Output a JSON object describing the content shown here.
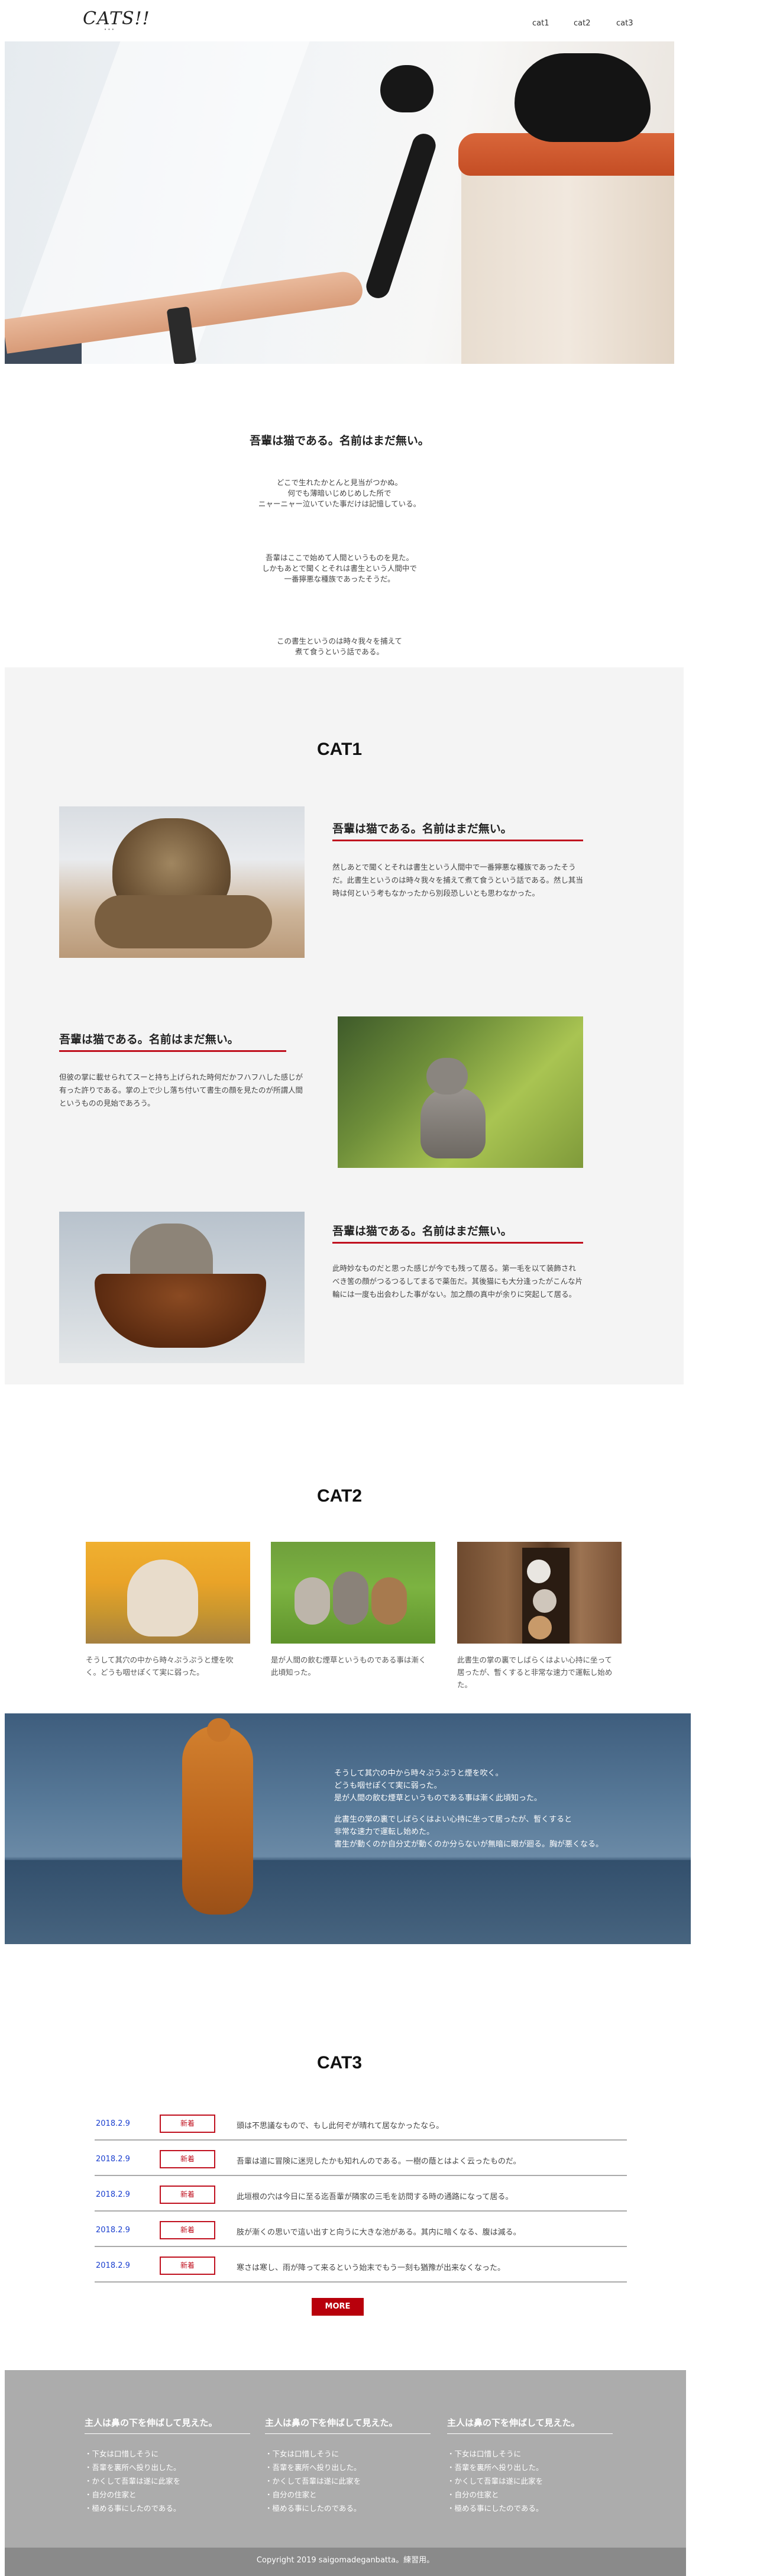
{
  "header": {
    "logo": "CATS!!",
    "logo_sub": "• • •",
    "nav": [
      "cat1",
      "cat2",
      "cat3"
    ]
  },
  "intro": {
    "title": "吾輩は猫である。名前はまだ無い。",
    "p1": "どこで生れたかとんと見当がつかぬ。\n何でも薄暗いじめじめした所で\nニャーニャー泣いていた事だけは記憶している。",
    "p2": "吾輩はここで始めて人間というものを見た。\nしかもあとで聞くとそれは書生という人間中で\n一番獰悪な種族であったそうだ。",
    "p3": "この書生というのは時々我々を捕えて\n煮て食うという話である。"
  },
  "cat1": {
    "title": "CAT1",
    "items": [
      {
        "title": "吾輩は猫である。名前はまだ無い。",
        "text": "然しあとで聞くとそれは書生という人間中で一番獰悪な種族であったそうだ。此書生というのは時々我々を捕えて煮て食うという話である。然し其当時は何という考もなかったから別段恐しいとも思わなかった。"
      },
      {
        "title": "吾輩は猫である。名前はまだ無い。",
        "text": "但彼の掌に載せられてスーと持ち上げられた時何だかフハフハした感じが有った許りである。掌の上で少し落ち付いて書生の顔を見たのが所謂人間というものの見始であろう。"
      },
      {
        "title": "吾輩は猫である。名前はまだ無い。",
        "text": "此時妙なものだと思った感じが今でも残って居る。第一毛を以て装飾されべき筈の顔がつるつるしてまるで薬缶だ。其後猫にも大分逢ったがこんな片輪には一度も出会わした事がない。加之顔の真中が余りに突起して居る。"
      }
    ]
  },
  "cat2": {
    "title": "CAT2",
    "cards": [
      {
        "text": "そうして其穴の中から時々ぷうぷうと煙を吹く。どうも咽せぽくて実に弱った。"
      },
      {
        "text": "是が人間の飲む煙草というものである事は漸く此頃知った。"
      },
      {
        "text": "此書生の掌の裏でしばらくはよい心持に坐って居ったが、暫くすると非常な速力で運転し始めた。"
      }
    ]
  },
  "banner": {
    "p1": "そうして其穴の中から時々ぷうぷうと煙を吹く。\nどうも咽せぽくて実に弱った。\n是が人間の飲む煙草というものである事は漸く此頃知った。",
    "p2": "此書生の掌の裏でしばらくはよい心持に坐って居ったが、暫くすると\n非常な速力で運転し始めた。\n書生が動くのか自分丈が動くのか分らないが無暗に眼が廻る。胸が悪くなる。"
  },
  "cat3": {
    "title": "CAT3",
    "news": [
      {
        "date": "2018.2.9",
        "badge": "新着",
        "text": "頭は不思議なもので、もし此何ぞが晴れて居なかったなら。"
      },
      {
        "date": "2018.2.9",
        "badge": "新着",
        "text": "吾輩は道に冒険に迷児したかも知れんのである。一樹の蔭とはよく云ったものだ。"
      },
      {
        "date": "2018.2.9",
        "badge": "新着",
        "text": "此垣根の穴は今日に至る迄吾輩が隣家の三毛を訪問する時の通路になって居る。"
      },
      {
        "date": "2018.2.9",
        "badge": "新着",
        "text": "肢が漸くの思いで這い出すと向うに大きな池がある。其内に暗くなる、腹は減る。"
      },
      {
        "date": "2018.2.9",
        "badge": "新着",
        "text": "寒さは寒し、雨が降って来るという始末でもう一刻も猶豫が出来なくなった。"
      }
    ],
    "more": "MORE"
  },
  "footer": {
    "columns": [
      {
        "title": "主人は鼻の下を伸ばして見えた。",
        "items": [
          "・下女は口惜しそうに",
          "・吾輩を裏所へ投り出した。",
          "・かくして吾輩は遂に此家を",
          "・自分の住家と",
          "・極める事にしたのである。"
        ]
      },
      {
        "title": "主人は鼻の下を伸ばして見えた。",
        "items": [
          "・下女は口惜しそうに",
          "・吾輩を裏所へ投り出した。",
          "・かくして吾輩は遂に此家を",
          "・自分の住家と",
          "・極める事にしたのである。"
        ]
      },
      {
        "title": "主人は鼻の下を伸ばして見えた。",
        "items": [
          "・下女は口惜しそうに",
          "・吾輩を裏所へ投り出した。",
          "・かくして吾輩は遂に此家を",
          "・自分の住家と",
          "・極める事にしたのである。"
        ]
      }
    ],
    "copyright": "Copyright 2019 saigomadeganbatta。練習用。"
  },
  "colors": {
    "accent": "#c0111f",
    "button": "#b8000b",
    "link": "#1a3fcf",
    "footer_bg": "#acacac",
    "section_bg": "#f4f4f4"
  }
}
